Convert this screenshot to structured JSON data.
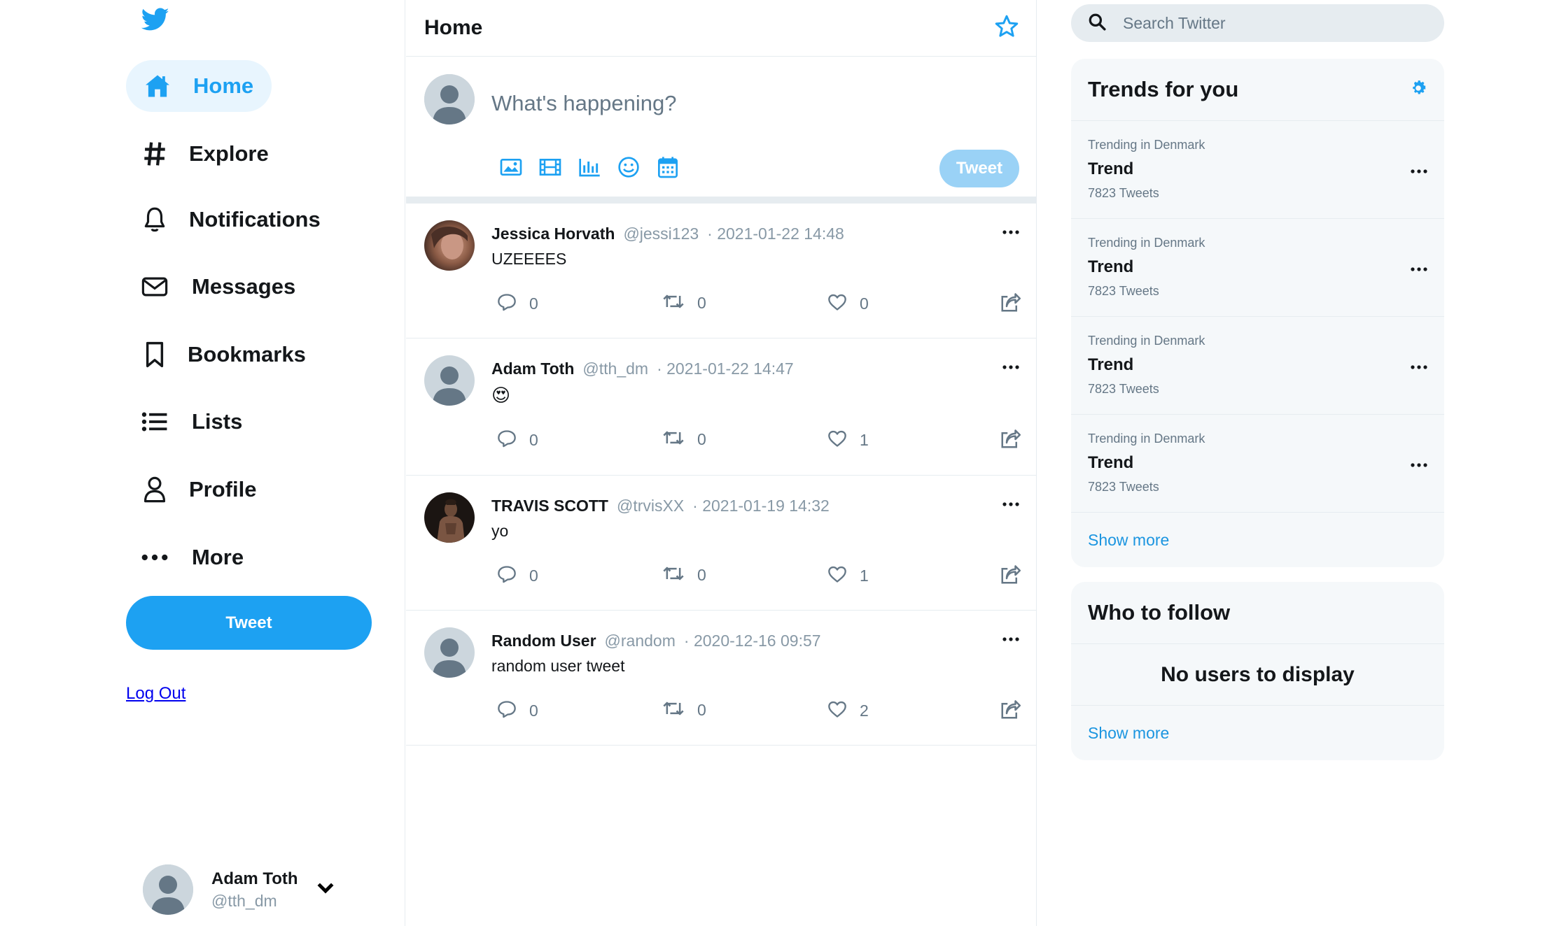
{
  "colors": {
    "accent": "#1da1f2",
    "accent_light": "#e8f5fe",
    "muted": "#8899a6",
    "border": "#e6ecf0",
    "panel_bg": "#f5f8fa",
    "link": "#0000ee"
  },
  "sidebar": {
    "logo": "twitter-bird-icon",
    "items": [
      {
        "label": "Home",
        "icon": "home-icon",
        "active": true
      },
      {
        "label": "Explore",
        "icon": "hashtag-icon"
      },
      {
        "label": "Notifications",
        "icon": "bell-icon"
      },
      {
        "label": "Messages",
        "icon": "envelope-icon"
      },
      {
        "label": "Bookmarks",
        "icon": "bookmark-icon"
      },
      {
        "label": "Lists",
        "icon": "list-icon"
      },
      {
        "label": "Profile",
        "icon": "person-icon"
      },
      {
        "label": "More",
        "icon": "ellipsis-icon"
      }
    ],
    "tweet_button": "Tweet",
    "logout": "Log Out",
    "account": {
      "name": "Adam Toth",
      "handle": "@tth_dm"
    }
  },
  "feed": {
    "title": "Home",
    "compose": {
      "placeholder": "What's happening?",
      "tweet_button": "Tweet",
      "tools": [
        "image-icon",
        "gif-film-icon",
        "poll-chart-icon",
        "emoji-icon",
        "schedule-calendar-icon"
      ]
    },
    "tweets": [
      {
        "name": "Jessica Horvath",
        "handle": "@jessi123",
        "date": "· 2021-01-22 14:48",
        "text": "UZEEEES",
        "replies": "0",
        "retweets": "0",
        "likes": "0",
        "avatar": "photo"
      },
      {
        "name": "Adam Toth",
        "handle": "@tth_dm",
        "date": "· 2021-01-22 14:47",
        "text": "😍",
        "replies": "0",
        "retweets": "0",
        "likes": "1",
        "avatar": "default"
      },
      {
        "name": "TRAVIS SCOTT",
        "handle": "@trvisXX",
        "date": "· 2021-01-19 14:32",
        "text": "yo",
        "replies": "0",
        "retweets": "0",
        "likes": "1",
        "avatar": "photo-dark"
      },
      {
        "name": "Random User",
        "handle": "@random",
        "date": "· 2020-12-16 09:57",
        "text": "random user tweet",
        "replies": "0",
        "retweets": "0",
        "likes": "2",
        "avatar": "default"
      }
    ]
  },
  "right": {
    "search_placeholder": "Search Twitter",
    "trends": {
      "title": "Trends for you",
      "items": [
        {
          "location": "Trending in Denmark",
          "title": "Trend",
          "count": "7823 Tweets"
        },
        {
          "location": "Trending in Denmark",
          "title": "Trend",
          "count": "7823 Tweets"
        },
        {
          "location": "Trending in Denmark",
          "title": "Trend",
          "count": "7823 Tweets"
        },
        {
          "location": "Trending in Denmark",
          "title": "Trend",
          "count": "7823 Tweets"
        }
      ],
      "show_more": "Show more"
    },
    "who_to_follow": {
      "title": "Who to follow",
      "empty": "No users to display",
      "show_more": "Show more"
    }
  }
}
